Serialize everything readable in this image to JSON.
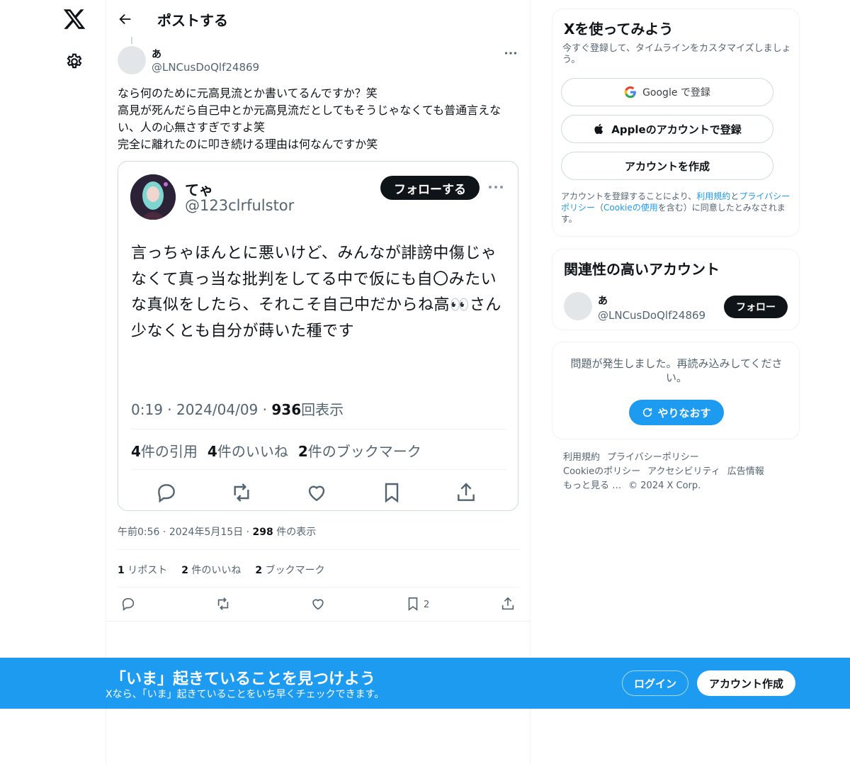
{
  "nav": {
    "logo_icon": "x-logo-icon",
    "settings_icon": "gear-icon"
  },
  "header": {
    "title": "ポストする",
    "back_icon": "arrow-left-icon"
  },
  "post": {
    "author_name": "あ",
    "author_handle": "@LNCusDoQlf24869",
    "text": "なら何のために元高見流とか書いてるんですか？笑\n高見が死んだら自己中とか元高見流だとしてもそうじゃなくても普通言えない、人の心無さすぎですよ笑\n完全に離れたのに叩き続ける理由は何なんですか笑",
    "time": "午前0:56",
    "date": "2024年5月15日",
    "views_count": "298",
    "views_label": "件の表示",
    "reposts_count": "1",
    "reposts_label": "リポスト",
    "likes_count": "2",
    "likes_label": "件のいいね",
    "bookmarks_count": "2",
    "bookmarks_label": "ブックマーク",
    "bookmark_action_count": "2"
  },
  "embed": {
    "name": "てゃ",
    "handle": "@123clrfulstor",
    "follow_label": "フォローする",
    "text": "言っちゃほんとに悪いけど、みんなが誹謗中傷じゃなくて真っ当な批判をしてる中で仮にも自〇みたいな真似をしたら、それこそ自己中だからね高👀さん\n少なくとも自分が蒔いた種です",
    "time": "0:19",
    "date": "2024/04/09",
    "views_count": "936",
    "views_label": "回表示",
    "quotes_count": "4",
    "quotes_label": "件の引用",
    "likes_count": "4",
    "likes_label": "件のいいね",
    "bookmarks_count": "2",
    "bookmarks_label": "件のブックマーク"
  },
  "signup": {
    "title": "Xを使ってみよう",
    "subtitle": "今すぐ登録して、タイムラインをカスタマイズしましょう。",
    "google_label": "Google で登録",
    "apple_label": "Appleのアカウントで登録",
    "create_label": "アカウントを作成",
    "terms_pre": "アカウントを登録することにより、",
    "terms_link": "利用規約",
    "terms_and": "と",
    "privacy_link": "プライバシーポリシー",
    "terms_mid": "（",
    "cookie_link": "Cookieの使用",
    "terms_post": "を含む）に同意したとみなされます。"
  },
  "related": {
    "title": "関連性の高いアカウント",
    "name": "あ",
    "handle": "@LNCusDoQlf24869",
    "follow_label": "フォロー"
  },
  "error": {
    "message": "問題が発生しました。再読み込みしてください。",
    "retry_label": "やりなおす"
  },
  "footer": {
    "links": [
      "利用規約",
      "プライバシーポリシー",
      "Cookieのポリシー",
      "アクセシビリティ",
      "広告情報",
      "もっと見る …",
      "© 2024 X Corp."
    ]
  },
  "banner": {
    "title": "「いま」起きていることを見つけよう",
    "subtitle": "Xなら、「いま」起きていることをいち早くチェックできます。",
    "login_label": "ログイン",
    "signup_label": "アカウント作成"
  },
  "colors": {
    "accent": "#1d9bf0",
    "text": "#0f1419",
    "muted": "#536471",
    "border": "#eff3f4"
  }
}
